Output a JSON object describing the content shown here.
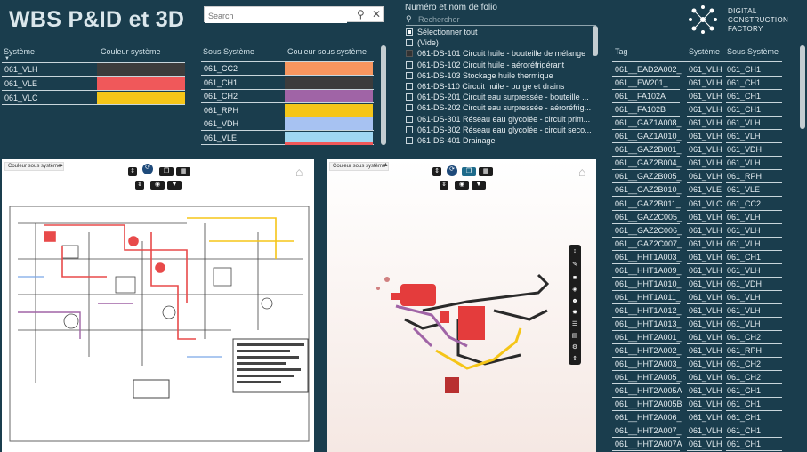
{
  "title": "WBS P&ID et 3D",
  "search": {
    "placeholder": "Search"
  },
  "brand": {
    "line1": "DIGITAL",
    "line2": "CONSTRUCTION",
    "line3": "FACTORY"
  },
  "systeme_table": {
    "headers": [
      "Système",
      "Couleur système"
    ],
    "rows": [
      {
        "name": "061_VLH",
        "color": "#3c3c3c"
      },
      {
        "name": "061_VLE",
        "color": "#f0585a"
      },
      {
        "name": "061_VLC",
        "color": "#f5c518"
      }
    ]
  },
  "sous_systeme_table": {
    "headers": [
      "Sous Système",
      "Couleur sous système"
    ],
    "rows": [
      {
        "name": "061_CC2",
        "color": "#f7965f"
      },
      {
        "name": "061_CH1",
        "color": "#3c3c3c"
      },
      {
        "name": "061_CH2",
        "color": "#a064a6"
      },
      {
        "name": "061_RPH",
        "color": "#f5c518"
      },
      {
        "name": "061_VDH",
        "color": "#a7c2f2"
      },
      {
        "name": "061_VLE",
        "color": "#9fd7f2"
      }
    ]
  },
  "folio": {
    "title": "Numéro et nom de folio",
    "search_placeholder": "Rechercher",
    "items": [
      {
        "label": "Sélectionner tout",
        "state": "partial"
      },
      {
        "label": "(Vide)",
        "state": "off"
      },
      {
        "label": "061-DS-101 Circuit huile - bouteille de mélange",
        "state": "on"
      },
      {
        "label": "061-DS-102 Circuit huile - aéroréfrigérant",
        "state": "off"
      },
      {
        "label": "061-DS-103 Stockage huile thermique",
        "state": "off"
      },
      {
        "label": "061-DS-110 Circuit huile - purge et drains",
        "state": "off"
      },
      {
        "label": "061-DS-201 Circuit eau surpressée - bouteille ...",
        "state": "off"
      },
      {
        "label": "061-DS-202 Circuit eau surpressée - aéroréfrig...",
        "state": "off"
      },
      {
        "label": "061-DS-301 Réseau eau glycolée - circuit prim...",
        "state": "off"
      },
      {
        "label": "061-DS-302 Réseau eau glycolée - circuit seco...",
        "state": "off"
      },
      {
        "label": "061-DS-401 Drainage",
        "state": "off"
      }
    ]
  },
  "tag_table": {
    "headers": [
      "Tag",
      "Système",
      "Sous Système"
    ],
    "rows": [
      [
        "061__EAD2A002_",
        "061_VLH",
        "061_CH1"
      ],
      [
        "061__EW201_",
        "061_VLH",
        "061_CH1"
      ],
      [
        "061__FA102A",
        "061_VLH",
        "061_CH1"
      ],
      [
        "061__FA102B",
        "061_VLH",
        "061_CH1"
      ],
      [
        "061__GAZ1A008_",
        "061_VLH",
        "061_VLH"
      ],
      [
        "061__GAZ1A010_",
        "061_VLH",
        "061_VLH"
      ],
      [
        "061__GAZ2B001_",
        "061_VLH",
        "061_VDH"
      ],
      [
        "061__GAZ2B004_",
        "061_VLH",
        "061_VLH"
      ],
      [
        "061__GAZ2B005_",
        "061_VLH",
        "061_RPH"
      ],
      [
        "061__GAZ2B010_",
        "061_VLE",
        "061_VLE"
      ],
      [
        "061__GAZ2B011_",
        "061_VLC",
        "061_CC2"
      ],
      [
        "061__GAZ2C005_",
        "061_VLH",
        "061_VLH"
      ],
      [
        "061__GAZ2C006_",
        "061_VLH",
        "061_VLH"
      ],
      [
        "061__GAZ2C007_",
        "061_VLH",
        "061_VLH"
      ],
      [
        "061__HHT1A003_",
        "061_VLH",
        "061_CH1"
      ],
      [
        "061__HHT1A009_",
        "061_VLH",
        "061_VLH"
      ],
      [
        "061__HHT1A010_",
        "061_VLH",
        "061_VDH"
      ],
      [
        "061__HHT1A011_",
        "061_VLH",
        "061_VLH"
      ],
      [
        "061__HHT1A012_",
        "061_VLH",
        "061_VLH"
      ],
      [
        "061__HHT1A013_",
        "061_VLH",
        "061_VLH"
      ],
      [
        "061__HHT2A001_",
        "061_VLH",
        "061_CH2"
      ],
      [
        "061__HHT2A002_",
        "061_VLH",
        "061_RPH"
      ],
      [
        "061__HHT2A003_",
        "061_VLH",
        "061_CH2"
      ],
      [
        "061__HHT2A005_",
        "061_VLH",
        "061_CH2"
      ],
      [
        "061__HHT2A005A",
        "061_VLH",
        "061_CH1"
      ],
      [
        "061__HHT2A005B",
        "061_VLH",
        "061_CH1"
      ],
      [
        "061__HHT2A006_",
        "061_VLH",
        "061_CH1"
      ],
      [
        "061__HHT2A007_",
        "061_VLH",
        "061_CH1"
      ],
      [
        "061__HHT2A007A",
        "061_VLH",
        "061_CH1"
      ]
    ]
  },
  "viewer_2d": {
    "label": "Couleur sous système"
  },
  "viewer_3d": {
    "label": "Couleur sous système"
  },
  "colors": {
    "background": "#1a3d4d",
    "panel": "#ffffff"
  }
}
